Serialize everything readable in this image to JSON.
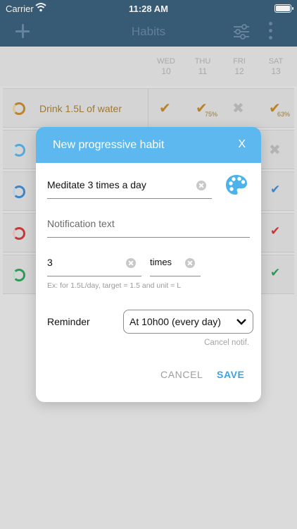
{
  "status_bar": {
    "carrier": "Carrier",
    "time": "11:28 AM"
  },
  "app_bar": {
    "title": "Habits"
  },
  "days": [
    {
      "weekday": "WED",
      "date": "10"
    },
    {
      "weekday": "THU",
      "date": "11"
    },
    {
      "weekday": "FRI",
      "date": "12"
    },
    {
      "weekday": "SAT",
      "date": "13"
    }
  ],
  "habits": [
    {
      "name": "Drink 1.5L of water",
      "ring_color": "#c98b2d",
      "thu_percent": "75%",
      "sat_percent": "63%"
    },
    {
      "name": "",
      "ring_color": "#5ab3e6"
    },
    {
      "name": "",
      "ring_color": "#3c8fd6"
    },
    {
      "name": "",
      "ring_color": "#d13b3b"
    },
    {
      "name": "",
      "ring_color": "#2fa45a"
    }
  ],
  "colors": {
    "check_orange": "#c48a2a",
    "check_blue": "#3c8fd6",
    "check_red": "#d13b3b",
    "check_green": "#2fa45a",
    "cross_gray": "#bdbdbd"
  },
  "dialog": {
    "title": "New progressive habit",
    "close_label": "X",
    "habit_name_value": "Meditate 3 times a day",
    "notification_placeholder": "Notification text",
    "target_value": "3",
    "unit_value": "times",
    "hint": "Ex: for 1.5L/day, target = 1.5 and unit = L",
    "reminder_label": "Reminder",
    "reminder_value": "At 10h00 (every day)",
    "cancel_notif_label": "Cancel notif.",
    "cancel_label": "CANCEL",
    "save_label": "SAVE",
    "palette_icon": "palette-icon"
  }
}
